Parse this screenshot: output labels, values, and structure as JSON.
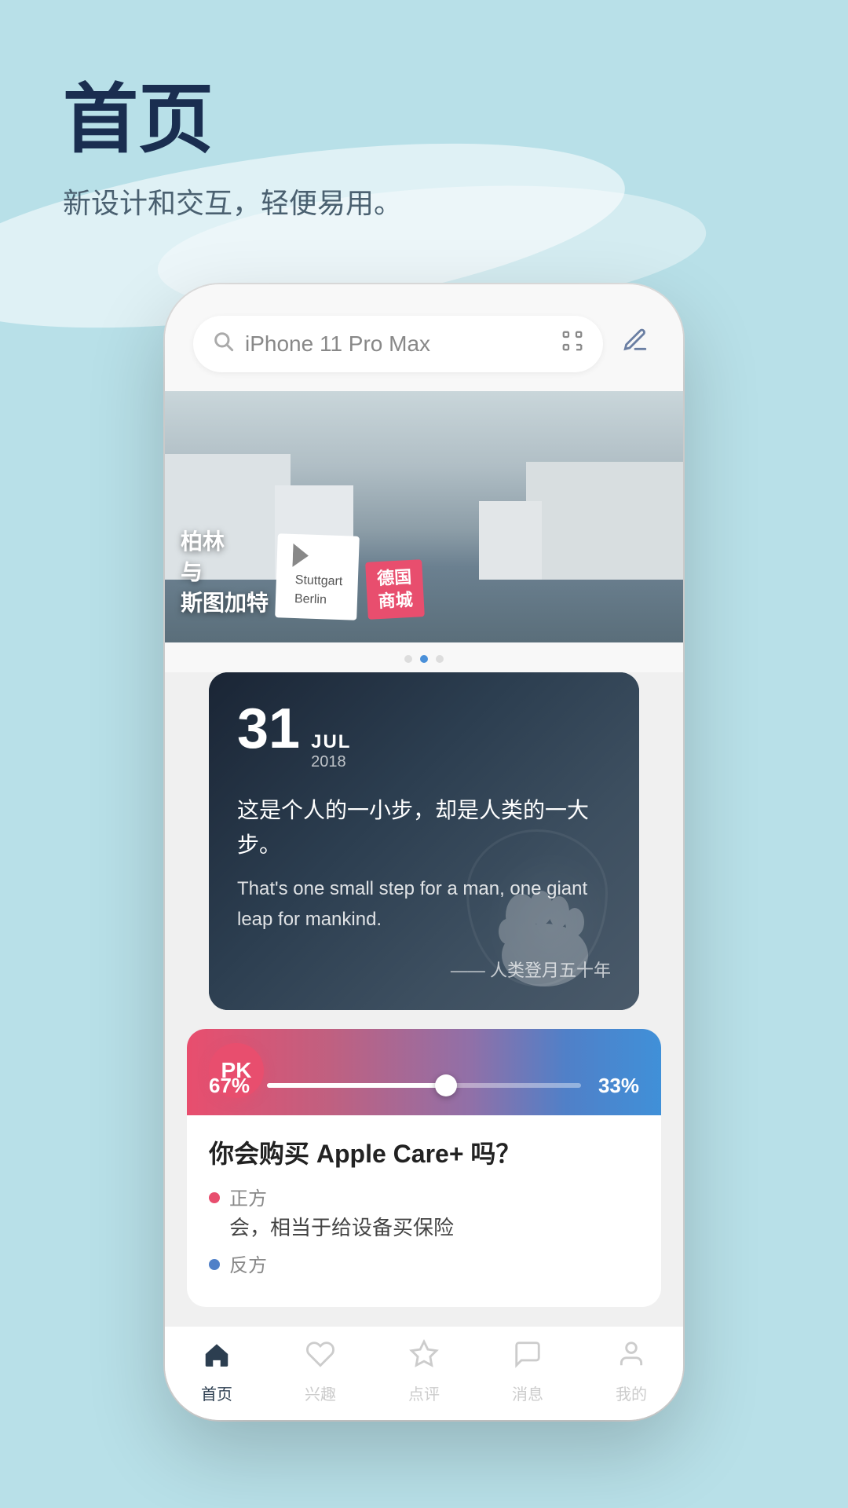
{
  "page": {
    "title": "首页",
    "subtitle": "新设计和交互，轻便易用。",
    "bg_color": "#b8e0e8"
  },
  "search": {
    "placeholder": "iPhone 11 Pro Max",
    "scan_label": "scan",
    "edit_label": "edit"
  },
  "banner": {
    "tag_line1": "德国",
    "tag_line2": "商城",
    "card_title": "柏林",
    "card_subtitle1": "与",
    "card_subtitle2": "斯图加特",
    "card_small": "Stuttgart\nBerlin",
    "dots": [
      {
        "active": false
      },
      {
        "active": true
      },
      {
        "active": false
      }
    ]
  },
  "date_card": {
    "day": "31",
    "month": "JUL",
    "year": "2018",
    "quote_zh": "这是个人的一小步，却是人类的一大步。",
    "quote_en": "That's one small step for a man, one giant leap for mankind.",
    "source": "—— 人类登月五十年"
  },
  "pk_card": {
    "badge": "PK",
    "pct_left": "67%",
    "pct_right": "33%",
    "question": "你会购买 Apple Care+ 吗？",
    "option_red_label": "正方",
    "option_red_text": "会，相当于给设备买保险",
    "option_blue_label": "反方"
  },
  "tabbar": {
    "items": [
      {
        "label": "首页",
        "icon": "home",
        "active": true
      },
      {
        "label": "兴趣",
        "icon": "heart",
        "active": false
      },
      {
        "label": "点评",
        "icon": "star",
        "active": false
      },
      {
        "label": "消息",
        "icon": "message",
        "active": false
      },
      {
        "label": "我的",
        "icon": "person",
        "active": false
      }
    ]
  }
}
